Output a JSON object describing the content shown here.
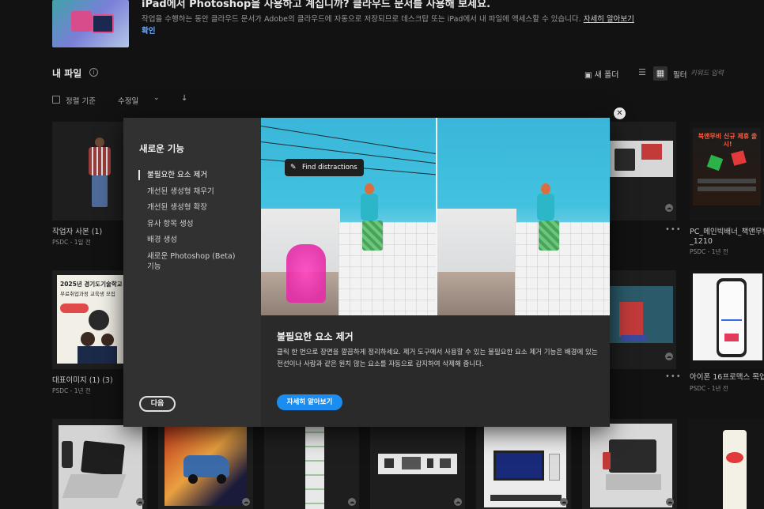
{
  "banner": {
    "title": "iPad에서 Photoshop을 사용하고 계십니까? 클라우드 문서를 사용해 보세요.",
    "description": "작업을 수행하는 동안 클라우드 문서가 Adobe의 클라우드에 자동으로 저장되므로 데스크탑 또는 iPad에서 내 파일에 액세스할 수 있습니다.",
    "learn_more": "자세히 알아보기",
    "confirm": "확인"
  },
  "files": {
    "title": "내 파일",
    "new_folder": "새 폴더",
    "filter_label": "필터",
    "filter_placeholder": "키워드 입력",
    "sort_label": "정렬 기준",
    "sort_value": "수정일"
  },
  "tiles": [
    {
      "name": "작업자 사본 (1)",
      "meta": "PSDC - 1일 전"
    },
    {
      "name": "PC_메인빅배너_책앤무빈",
      "name2": "_1210",
      "meta": "PSDC - 1년 전"
    },
    {
      "name": "대표이미지 (1) (3)",
      "meta": "PSDC - 1년 전"
    },
    {
      "name": "아이폰 16프로맥스 목업",
      "meta": "PSDC - 1년 전"
    }
  ],
  "thumb_texts": {
    "poster_title": "2025년 경기도기술학교",
    "poster_sub": "무료취업과정 교육생 모집",
    "promo": "북앤무비 신규 제휴 출시!"
  },
  "modal": {
    "sidebar_title": "새로운 기능",
    "items": [
      "불필요한 요소 제거",
      "개선된 생성형 채우기",
      "개선된 생성형 확장",
      "유사 항목 생성",
      "배경 생성",
      "새로운 Photoshop (Beta) 기능"
    ],
    "next_button": "다음",
    "find_tag": "Find distractions",
    "content_title": "불필요한 요소 제거",
    "content_desc": "클릭 한 번으로 장면을 깔끔하게 정리하세요. 제거 도구에서 사용할 수 있는 불필요한 요소 제거 기능은 배경에 있는 전선이나 사람과 같은 원치 않는 요소를 자동으로 감지하여 삭제해 줍니다.",
    "learn_more_button": "자세히 알아보기"
  },
  "colors": {
    "accent": "#1b8cf0",
    "link": "#6ca9ff",
    "distraction_highlight": "#ff45c0"
  }
}
